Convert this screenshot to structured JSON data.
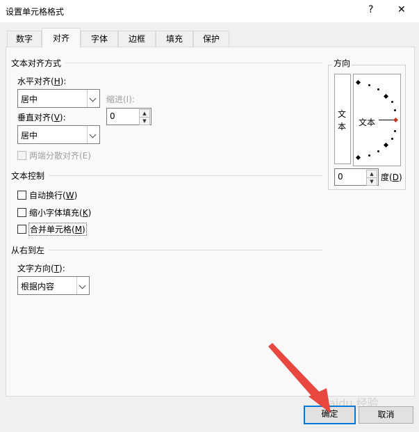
{
  "window": {
    "title": "设置单元格格式",
    "help_glyph": "?",
    "close_glyph": "✕"
  },
  "tabs": [
    {
      "label": "数字"
    },
    {
      "label": "对齐"
    },
    {
      "label": "字体"
    },
    {
      "label": "边框"
    },
    {
      "label": "填充"
    },
    {
      "label": "保护"
    }
  ],
  "active_tab": "对齐",
  "text_alignment": {
    "section_title": "文本对齐方式",
    "horizontal_label": "水平对齐(",
    "horizontal_key": "H",
    "horizontal_suffix": "):",
    "horizontal_value": "居中",
    "indent_label": "缩进(I):",
    "indent_value": "0",
    "vertical_label": "垂直对齐(",
    "vertical_key": "V",
    "vertical_suffix": "):",
    "vertical_value": "居中",
    "distributed_label": "两端分散对齐(E)"
  },
  "text_control": {
    "section_title": "文本控制",
    "wrap_label": "自动换行(",
    "wrap_key": "W",
    "wrap_suffix": ")",
    "shrink_label": "缩小字体填充(",
    "shrink_key": "K",
    "shrink_suffix": ")",
    "merge_label": "合并单元格(",
    "merge_key": "M",
    "merge_suffix": ")"
  },
  "rtl": {
    "section_title": "从右到左",
    "direction_label": "文字方向(",
    "direction_key": "T",
    "direction_suffix": "):",
    "direction_value": "根据内容"
  },
  "orientation": {
    "section_title": "方向",
    "vertical_text": "文本",
    "dial_text": "文本",
    "degree_value": "0",
    "degree_label": "度(",
    "degree_key": "D",
    "degree_suffix": ")"
  },
  "buttons": {
    "ok": "确定",
    "cancel": "取消"
  },
  "watermark": "Baidu 经验",
  "colors": {
    "arrow": "#e8473f",
    "focus": "#0078d7",
    "dial_marker": "#c0392b"
  }
}
